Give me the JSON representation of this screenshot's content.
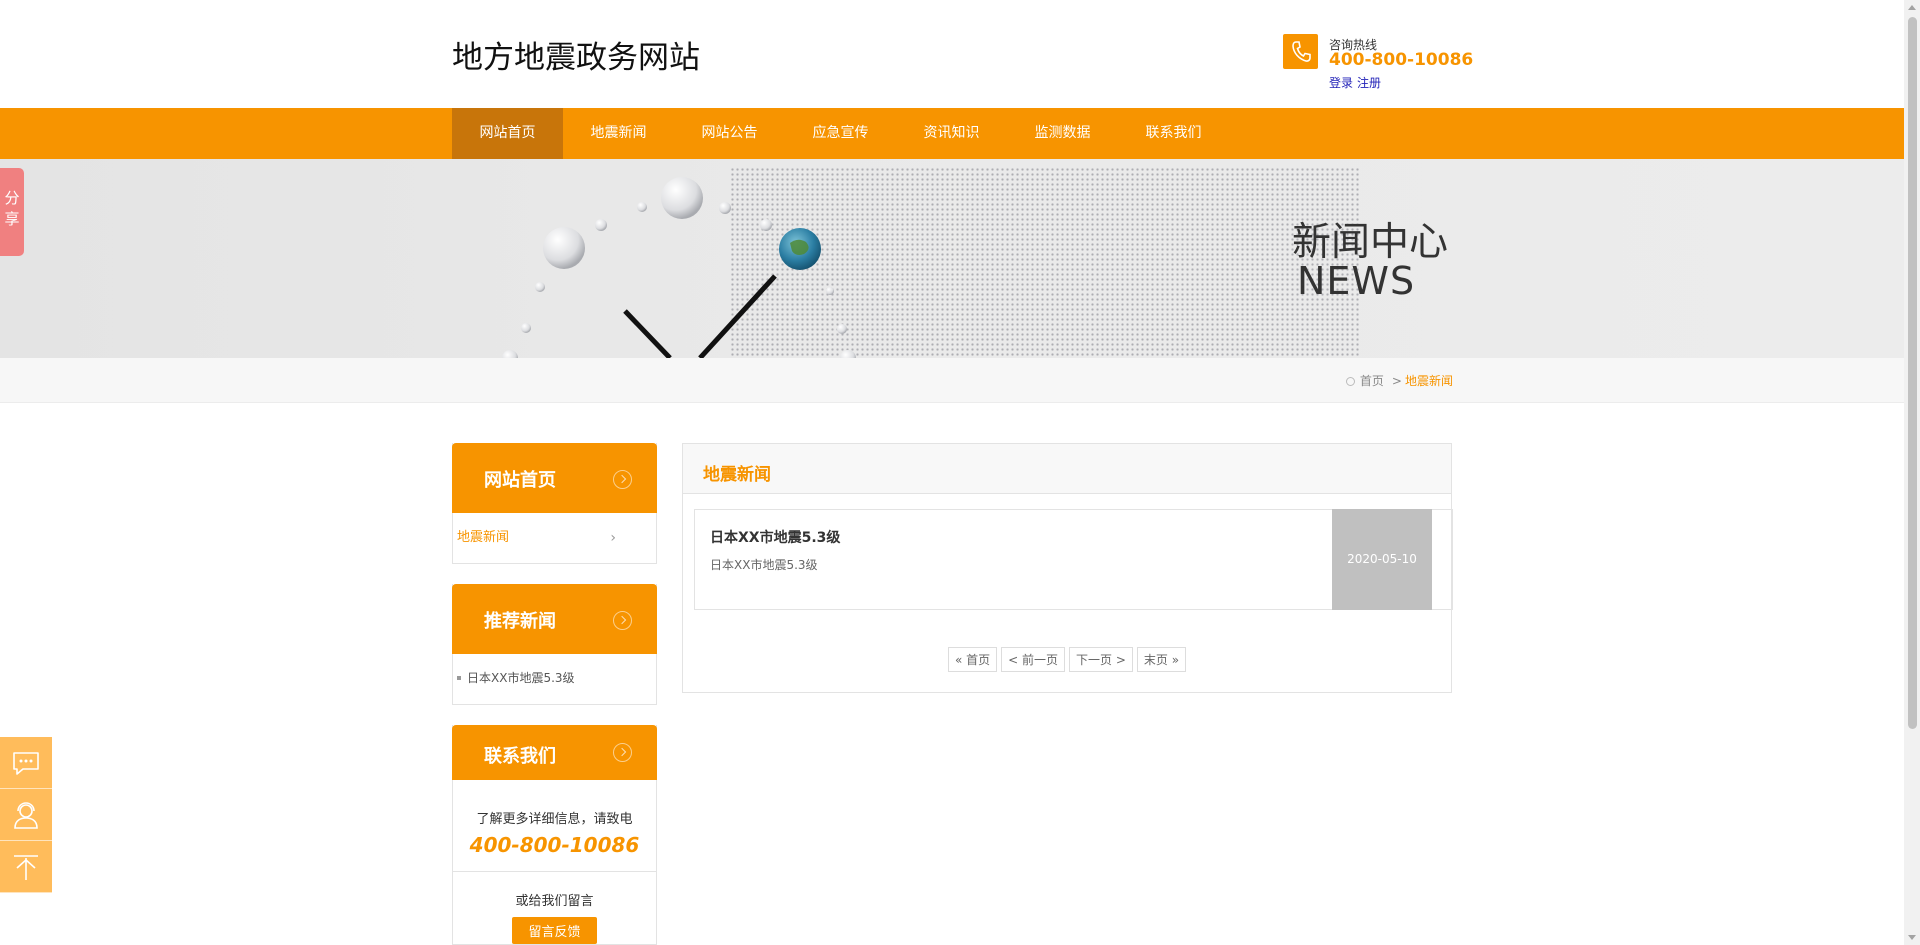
{
  "header": {
    "site_title": "地方地震政务网站",
    "hotline_label": "咨询热线",
    "hotline_number": "400-800-10086",
    "login": "登录",
    "register": "注册"
  },
  "nav": {
    "items": [
      "网站首页",
      "地震新闻",
      "网站公告",
      "应急宣传",
      "资讯知识",
      "监测数据",
      "联系我们"
    ],
    "active": "网站首页"
  },
  "banner": {
    "title": "新闻中心",
    "subtitle": "NEWS"
  },
  "breadcrumb": {
    "home": "首页",
    "separator": ">",
    "current": "地震新闻"
  },
  "sidebar": {
    "category_box": {
      "title": "网站首页",
      "item": "地震新闻"
    },
    "recommend_box": {
      "title": "推荐新闻",
      "item": "日本XX市地震5.3级"
    },
    "contact_box": {
      "title": "联系我们",
      "line1": "了解更多详细信息，请致电",
      "tel": "400-800-10086",
      "line2": "或给我们留言",
      "button": "留言反馈"
    }
  },
  "main": {
    "title": "地震新闻",
    "news": [
      {
        "title": "日本XX市地震5.3级",
        "desc": "日本XX市地震5.3级",
        "date": "2020-05-10"
      }
    ],
    "pager": {
      "first": "« 首页",
      "prev": "< 前一页",
      "next": "下一页 >",
      "last": "末页 »"
    }
  },
  "share_tab": "分享",
  "colors": {
    "accent": "#f79400",
    "accent_dark": "#c8750a",
    "float_tools": "#ffbc5b",
    "share_tab": "#f08080"
  },
  "icons": [
    "phone-icon",
    "chat-icon",
    "customer-service-icon",
    "back-to-top-icon"
  ]
}
